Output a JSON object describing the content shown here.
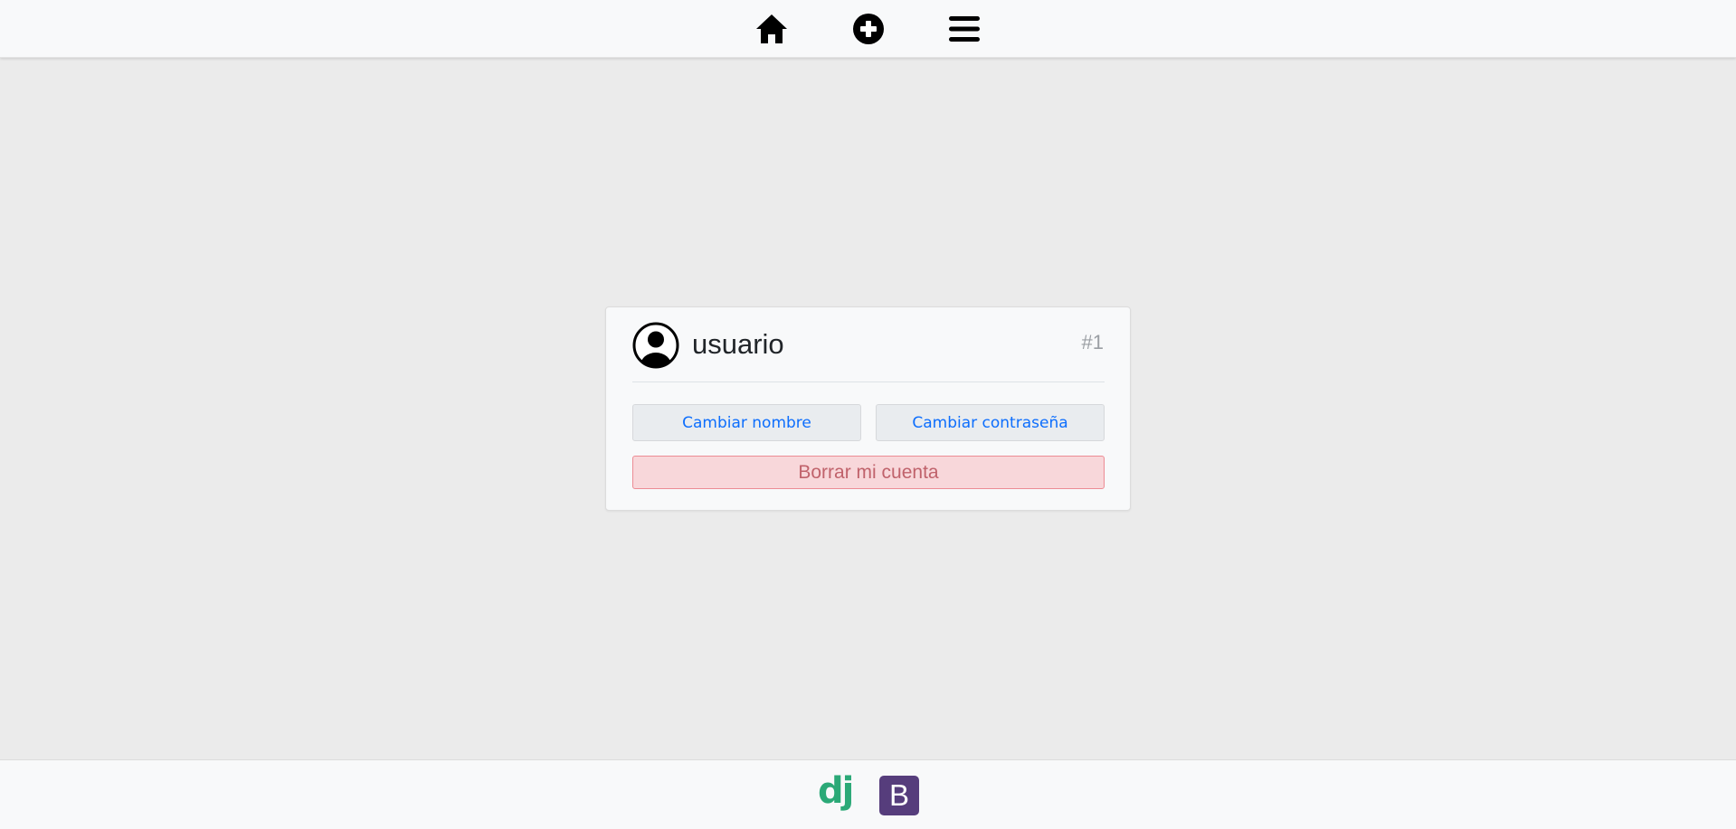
{
  "navbar": {
    "icons": [
      "home-icon",
      "plus-circle-icon",
      "menu-icon"
    ]
  },
  "profile": {
    "username": "usuario",
    "user_id": "#1",
    "change_name_label": "Cambiar nombre",
    "change_password_label": "Cambiar contraseña",
    "delete_account_label": "Borrar mi cuenta"
  },
  "footer": {
    "django_logo_text": "dj",
    "bootstrap_logo_text": "B"
  },
  "colors": {
    "page_background": "#ebebeb",
    "link_blue": "#0d6efd",
    "danger_background": "#f8d7da",
    "danger_text": "#c0626b",
    "django_green": "#2ba977",
    "bootstrap_purple": "#563d7c"
  }
}
